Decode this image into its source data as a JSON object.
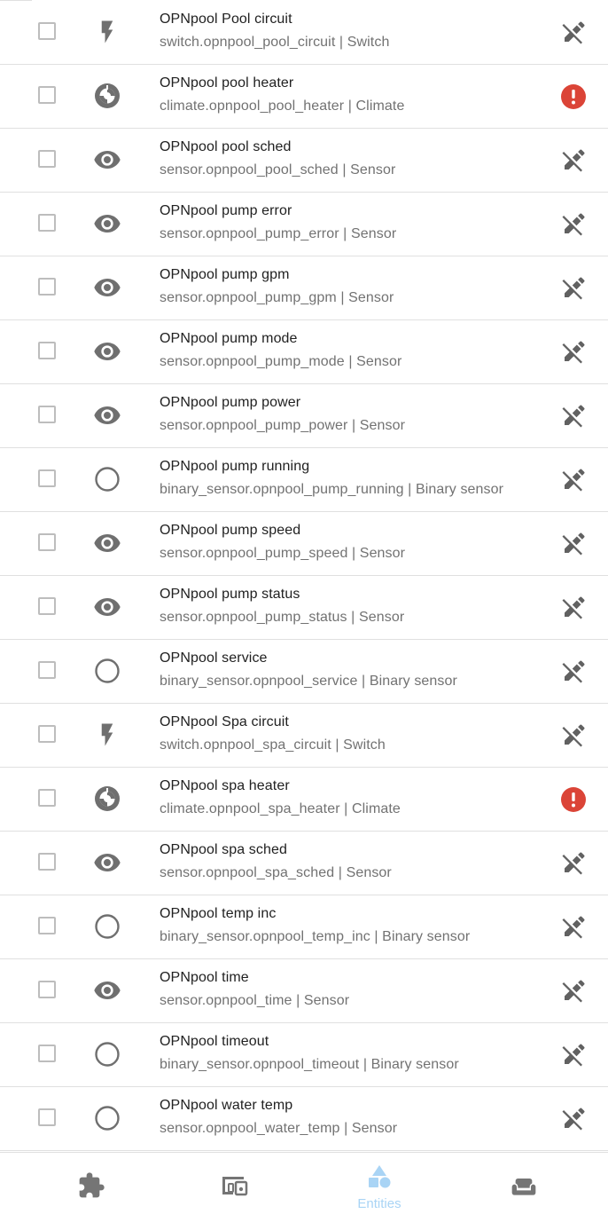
{
  "entities": [
    {
      "name": "OPNpool Pool circuit",
      "id_type": "switch.opnpool_pool_circuit | Switch",
      "icon": "flash-icon",
      "status": "readonly"
    },
    {
      "name": "OPNpool pool heater",
      "id_type": "climate.opnpool_pool_heater | Climate",
      "icon": "thermostat-icon",
      "status": "error"
    },
    {
      "name": "OPNpool pool sched",
      "id_type": "sensor.opnpool_pool_sched | Sensor",
      "icon": "eye-icon",
      "status": "readonly"
    },
    {
      "name": "OPNpool pump error",
      "id_type": "sensor.opnpool_pump_error | Sensor",
      "icon": "eye-icon",
      "status": "readonly"
    },
    {
      "name": "OPNpool pump gpm",
      "id_type": "sensor.opnpool_pump_gpm | Sensor",
      "icon": "eye-icon",
      "status": "readonly"
    },
    {
      "name": "OPNpool pump mode",
      "id_type": "sensor.opnpool_pump_mode | Sensor",
      "icon": "eye-icon",
      "status": "readonly"
    },
    {
      "name": "OPNpool pump power",
      "id_type": "sensor.opnpool_pump_power | Sensor",
      "icon": "eye-icon",
      "status": "readonly"
    },
    {
      "name": "OPNpool pump running",
      "id_type": "binary_sensor.opnpool_pump_running | Binary sensor",
      "icon": "circle-outline-icon",
      "status": "readonly"
    },
    {
      "name": "OPNpool pump speed",
      "id_type": "sensor.opnpool_pump_speed | Sensor",
      "icon": "eye-icon",
      "status": "readonly"
    },
    {
      "name": "OPNpool pump status",
      "id_type": "sensor.opnpool_pump_status | Sensor",
      "icon": "eye-icon",
      "status": "readonly"
    },
    {
      "name": "OPNpool service",
      "id_type": "binary_sensor.opnpool_service | Binary sensor",
      "icon": "circle-outline-icon",
      "status": "readonly"
    },
    {
      "name": "OPNpool Spa circuit",
      "id_type": "switch.opnpool_spa_circuit | Switch",
      "icon": "flash-icon",
      "status": "readonly"
    },
    {
      "name": "OPNpool spa heater",
      "id_type": "climate.opnpool_spa_heater | Climate",
      "icon": "thermostat-icon",
      "status": "error"
    },
    {
      "name": "OPNpool spa sched",
      "id_type": "sensor.opnpool_spa_sched | Sensor",
      "icon": "eye-icon",
      "status": "readonly"
    },
    {
      "name": "OPNpool temp inc",
      "id_type": "binary_sensor.opnpool_temp_inc | Binary sensor",
      "icon": "circle-outline-icon",
      "status": "readonly"
    },
    {
      "name": "OPNpool time",
      "id_type": "sensor.opnpool_time | Sensor",
      "icon": "eye-icon",
      "status": "readonly"
    },
    {
      "name": "OPNpool timeout",
      "id_type": "binary_sensor.opnpool_timeout | Binary sensor",
      "icon": "circle-outline-icon",
      "status": "readonly"
    },
    {
      "name": "OPNpool water temp",
      "id_type": "sensor.opnpool_water_temp | Sensor",
      "icon": "circle-outline-icon",
      "status": "readonly"
    }
  ],
  "tabbar": {
    "tabs": [
      {
        "icon": "puzzle-icon",
        "label": "",
        "active": false
      },
      {
        "icon": "devices-icon",
        "label": "",
        "active": false
      },
      {
        "icon": "shapes-icon",
        "label": "Entities",
        "active": true
      },
      {
        "icon": "sofa-icon",
        "label": "",
        "active": false
      }
    ]
  },
  "colors": {
    "icon_gray": "#6f6f6f",
    "readonly_icon": "#616161",
    "error_red": "#db4437",
    "active_tab": "#a9d4f5",
    "inactive_tab": "#757575",
    "divider": "#e0e0e0"
  }
}
